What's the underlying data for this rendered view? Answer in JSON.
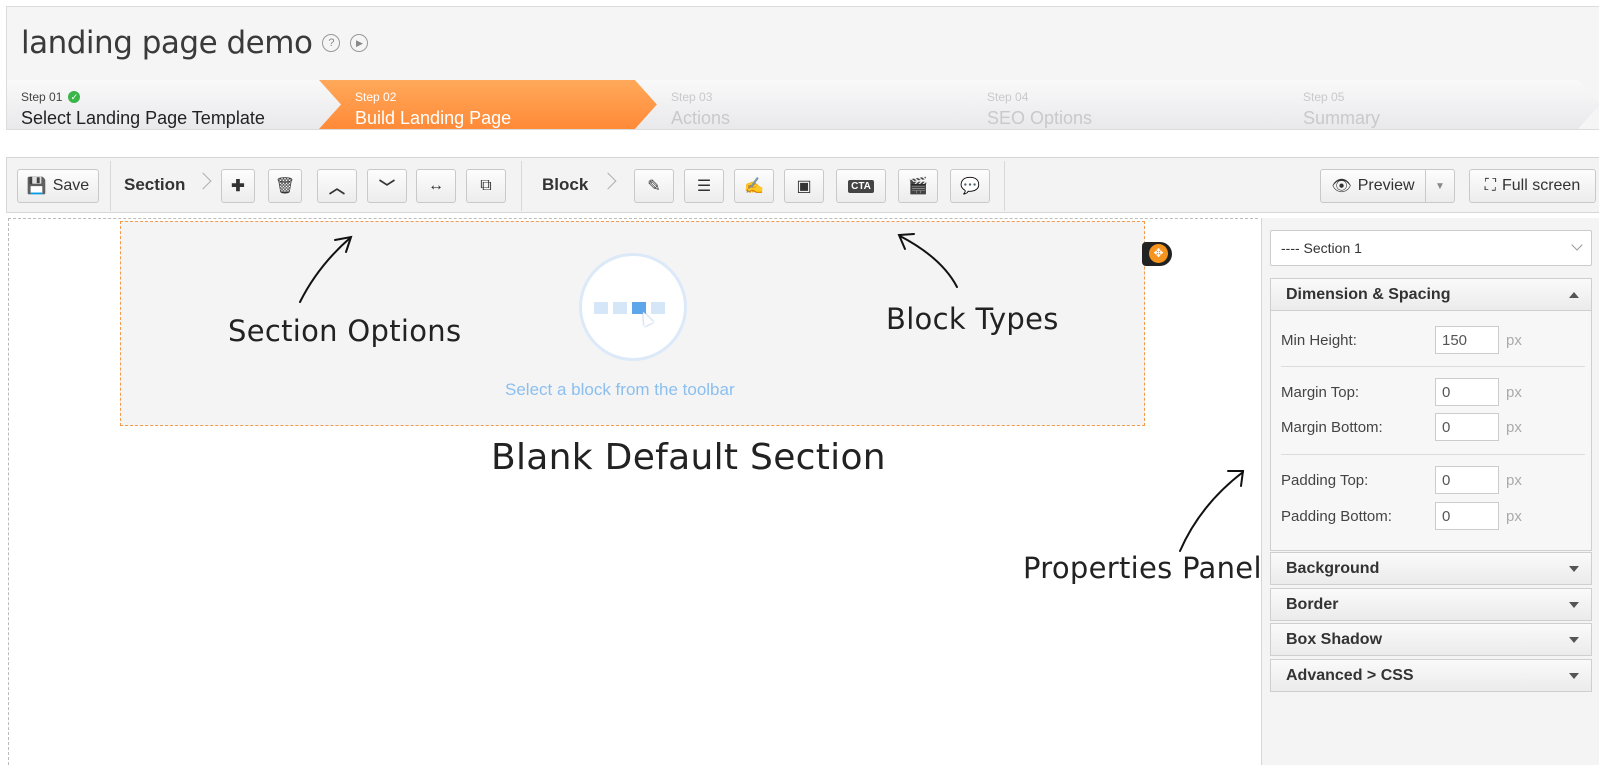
{
  "header": {
    "title": "landing page demo",
    "help_icon": "help-icon",
    "play_icon": "play-icon"
  },
  "steps": [
    {
      "num": "Step 01",
      "label": "Select Landing Page Template",
      "state": "completed"
    },
    {
      "num": "Step 02",
      "label": "Build Landing Page",
      "state": "active"
    },
    {
      "num": "Step 03",
      "label": "Actions",
      "state": "disabled"
    },
    {
      "num": "Step 04",
      "label": "SEO Options",
      "state": "disabled"
    },
    {
      "num": "Step 05",
      "label": "Summary",
      "state": "disabled"
    }
  ],
  "toolbar": {
    "save_label": "Save",
    "section_label": "Section",
    "block_label": "Block",
    "cta_label": "CTA",
    "preview_label": "Preview",
    "fullscreen_label": "Full screen"
  },
  "canvas": {
    "drop_text": "Select a block from the toolbar",
    "annotations": {
      "section_options": "Section Options",
      "block_types": "Block Types",
      "blank_section": "Blank Default Section",
      "properties_panel": "Properties Panel"
    }
  },
  "panel": {
    "section_select": "---- Section 1",
    "dimension_title": "Dimension & Spacing",
    "fields": {
      "min_height": {
        "label": "Min Height:",
        "value": "150",
        "unit": "px"
      },
      "margin_top": {
        "label": "Margin Top:",
        "value": "0",
        "unit": "px"
      },
      "margin_bottom": {
        "label": "Margin Bottom:",
        "value": "0",
        "unit": "px"
      },
      "padding_top": {
        "label": "Padding Top:",
        "value": "0",
        "unit": "px"
      },
      "padding_bottom": {
        "label": "Padding Bottom:",
        "value": "0",
        "unit": "px"
      }
    },
    "accordions": [
      "Background",
      "Border",
      "Box Shadow",
      "Advanced > CSS"
    ]
  },
  "colors": {
    "accent_orange": "#ff8a38",
    "check_green": "#3ab54a",
    "drop_blue": "#8bbfef"
  }
}
